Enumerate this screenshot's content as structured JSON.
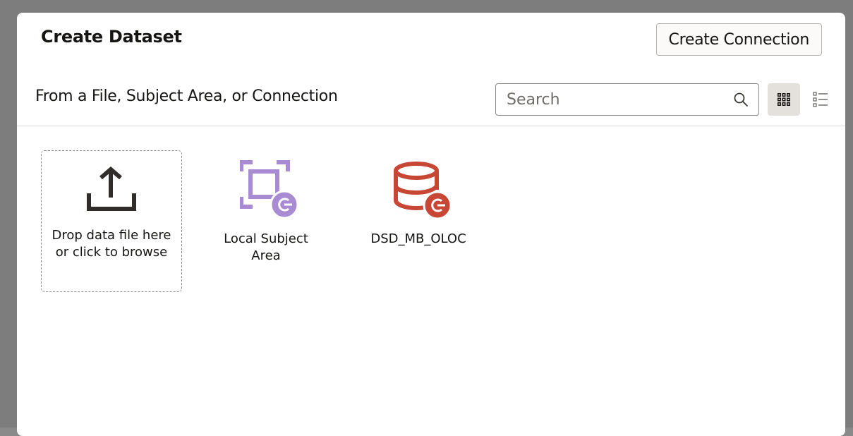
{
  "dialog": {
    "title": "Create Dataset",
    "create_connection_label": "Create Connection",
    "subtitle": "From a File, Subject Area, or Connection"
  },
  "search": {
    "placeholder": "Search",
    "value": "",
    "icon": "search-icon"
  },
  "view_toggle": {
    "active": "grid",
    "grid_icon": "grid-view-icon",
    "list_icon": "list-view-icon"
  },
  "sources": [
    {
      "label": "Drop data file here or click to browse",
      "icon": "upload-icon"
    },
    {
      "label": "Local Subject Area",
      "icon": "subject-area-icon",
      "color": "#a98bd3"
    },
    {
      "label": "DSD_MB_OLOC",
      "icon": "database-icon",
      "color": "#c74634"
    }
  ],
  "colors": {
    "backdrop": "#7d7d7d",
    "panel": "#ffffff",
    "text": "#161513",
    "subject_area": "#a98bd3",
    "database": "#c74634"
  }
}
